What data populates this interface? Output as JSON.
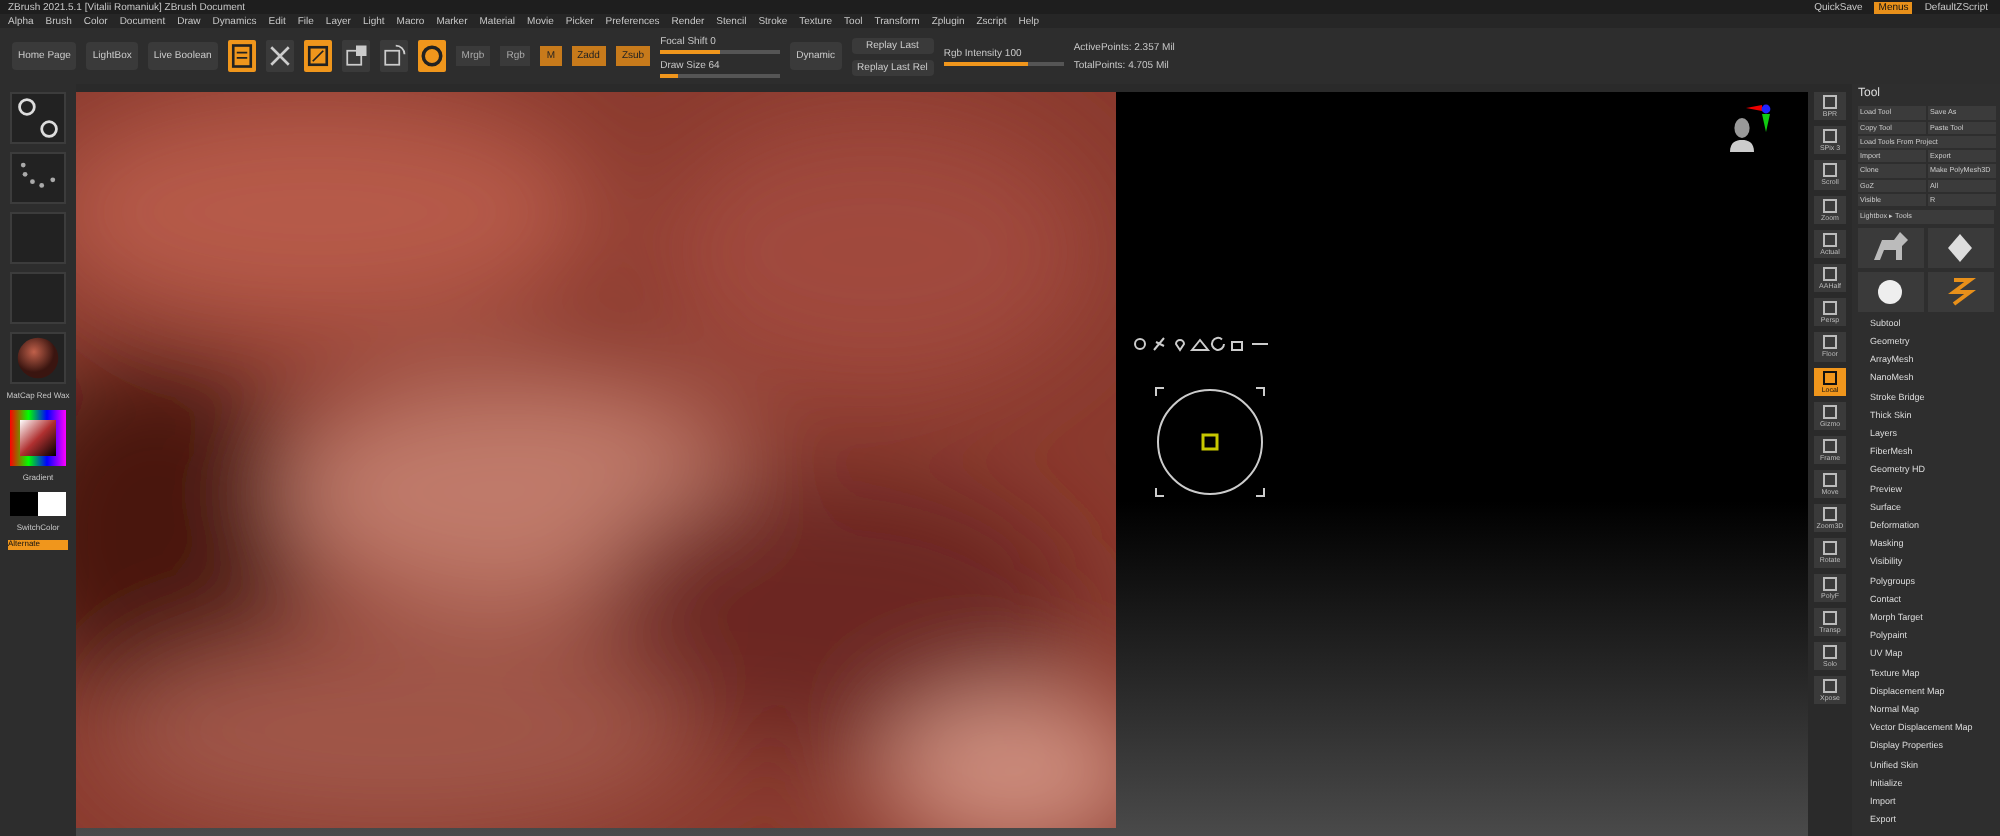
{
  "window": {
    "title": "ZBrush 2021.5.1 [Vitalii Romaniuk] ZBrush Document"
  },
  "title_right": [
    {
      "label": "QuickSave",
      "selected": false
    },
    {
      "label": "Menus",
      "selected": true
    },
    {
      "label": "DefaultZScript",
      "selected": false
    }
  ],
  "menus": [
    "Alpha",
    "Brush",
    "Color",
    "Document",
    "Draw",
    "Dynamics",
    "Edit",
    "File",
    "Layer",
    "Light",
    "Macro",
    "Marker",
    "Material",
    "Movie",
    "Picker",
    "Preferences",
    "Render",
    "Stencil",
    "Stroke",
    "Texture",
    "Tool",
    "Transform",
    "Zplugin",
    "Zscript",
    "Help"
  ],
  "shelf": {
    "buttons": [
      "Home Page",
      "LightBox",
      "Live Boolean"
    ],
    "tools": [
      {
        "kind": "edit",
        "selected": true
      },
      {
        "kind": "draw",
        "selected": false
      },
      {
        "kind": "move",
        "selected": true
      },
      {
        "kind": "scale",
        "selected": false
      },
      {
        "kind": "rotate",
        "selected": false
      },
      {
        "kind": "gizmo",
        "selected": true
      }
    ],
    "modes": [
      {
        "label": "Mrgb",
        "selected": false
      },
      {
        "label": "Rgb",
        "selected": false
      },
      {
        "label": "M",
        "selected": true
      },
      {
        "label": "Zadd",
        "selected": true
      },
      {
        "label": "Zsub",
        "selected": true
      }
    ],
    "sliders": [
      {
        "label": "Focal Shift 0",
        "level": 0.5
      },
      {
        "label": "Draw Size 64",
        "level": 0.15
      }
    ],
    "dynamic": "Dynamic",
    "replay": [
      "Replay Last",
      "Replay Last Rel"
    ],
    "intensity": {
      "label": "Rgb Intensity 100",
      "level": 0.7
    },
    "stats": [
      "ActivePoints: 2.357 Mil",
      "TotalPoints: 4.705 Mil"
    ]
  },
  "left_shelf": {
    "material": "MatCap Red Wax",
    "color_label": "Gradient",
    "swatch_label": "SwitchColor",
    "alternate": "Alternate"
  },
  "right_tools": [
    {
      "label": "BPR",
      "selected": false
    },
    {
      "label": "SPix 3",
      "selected": false
    },
    {
      "label": "Scroll",
      "selected": false
    },
    {
      "label": "Zoom",
      "selected": false
    },
    {
      "label": "Actual",
      "selected": false
    },
    {
      "label": "AAHalf",
      "selected": false
    },
    {
      "label": "Persp",
      "selected": false
    },
    {
      "label": "Floor",
      "selected": false
    },
    {
      "label": "Local",
      "selected": true
    },
    {
      "label": "Gizmo",
      "selected": false
    },
    {
      "label": "Frame",
      "selected": false
    },
    {
      "label": "Move",
      "selected": false
    },
    {
      "label": "Zoom3D",
      "selected": false
    },
    {
      "label": "Rotate",
      "selected": false
    },
    {
      "label": "PolyF",
      "selected": false
    },
    {
      "label": "Transp",
      "selected": false
    },
    {
      "label": "Solo",
      "selected": false
    },
    {
      "label": "Xpose",
      "selected": false
    }
  ],
  "tool_panel": {
    "title": "Tool",
    "buttons": [
      {
        "label": "Load Tool",
        "wide": false
      },
      {
        "label": "Save As",
        "wide": false
      },
      {
        "label": "Copy Tool",
        "wide": false
      },
      {
        "label": "Paste Tool",
        "wide": false
      },
      {
        "label": "Load Tools From Project",
        "wide": true
      },
      {
        "label": "Import",
        "wide": false
      },
      {
        "label": "Export",
        "wide": false
      },
      {
        "label": "Clone",
        "wide": false
      },
      {
        "label": "Make PolyMesh3D",
        "wide": false
      },
      {
        "label": "GoZ",
        "wide": false
      },
      {
        "label": "All",
        "wide": false
      },
      {
        "label": "Visible",
        "wide": false
      },
      {
        "label": "R",
        "wide": false
      }
    ],
    "lightbox": "Lightbox ▸ Tools",
    "sections": [
      "Subtool",
      "Geometry",
      "ArrayMesh",
      "NanoMesh",
      "Stroke Bridge",
      "Thick Skin",
      "Layers",
      "FiberMesh",
      "Geometry HD",
      "Preview",
      "Surface",
      "Deformation",
      "Masking",
      "Visibility",
      "Polygroups",
      "Contact",
      "Morph Target",
      "Polypaint",
      "UV Map",
      "Texture Map",
      "Displacement Map",
      "Normal Map",
      "Vector Displacement Map",
      "Display Properties",
      "Unified Skin",
      "Initialize",
      "Import",
      "Export"
    ]
  }
}
